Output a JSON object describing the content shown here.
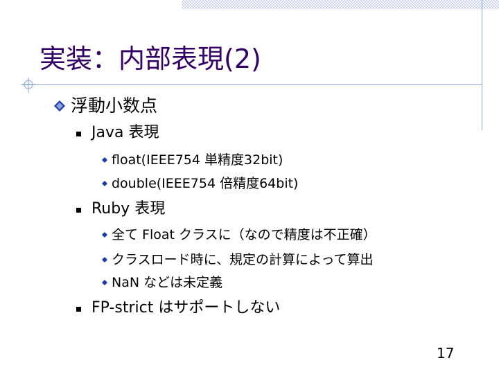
{
  "title": "実装：内部表現(2)",
  "heading": "浮動小数点",
  "sections": [
    {
      "label": "Java 表現",
      "items": [
        "float(IEEE754 単精度32bit)",
        "double(IEEE754 倍精度64bit)"
      ]
    },
    {
      "label": "Ruby 表現",
      "items": [
        "全て Float クラスに（なので精度は不正確）",
        "クラスロード時に、規定の計算によって算出",
        "NaN などは未定義"
      ]
    },
    {
      "label": "FP-strict はサポートしない",
      "items": []
    }
  ],
  "page_number": "17",
  "colors": {
    "title": "#330066",
    "accent": "#8aa0d8",
    "bullet_blue": "#1c3aa8",
    "checker": "#c8d2ee"
  },
  "icons": {
    "heading_bullet": "diamond-icon",
    "sub_bullet": "square-icon",
    "item_bullet": "small-diamond-icon"
  }
}
